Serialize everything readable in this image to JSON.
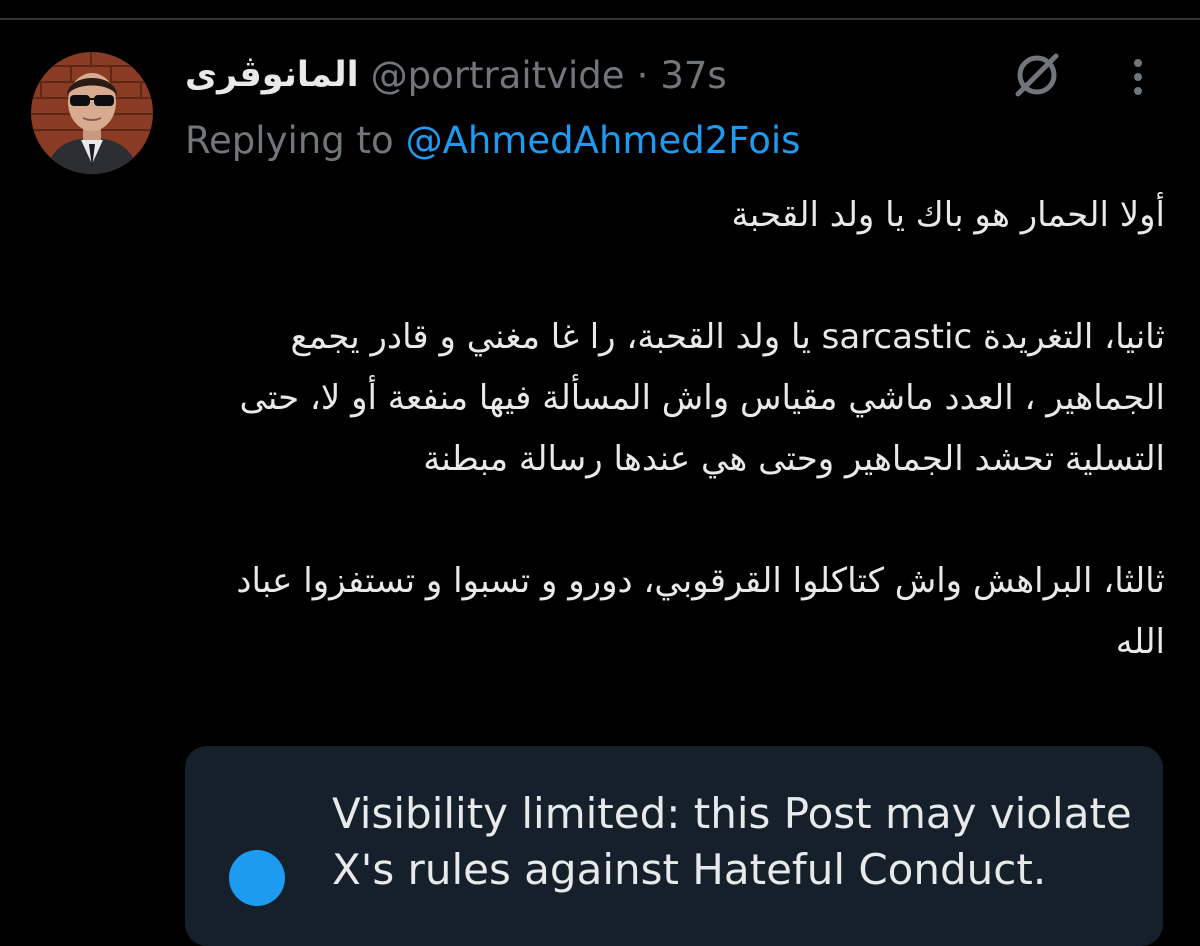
{
  "tweet": {
    "author": {
      "display_name": "المانوڤرى",
      "handle": "@portraitvide",
      "separator": "·",
      "timestamp": "37s"
    },
    "reply": {
      "prefix": "Replying to",
      "target": "@AhmedAhmed2Fois"
    },
    "paragraphs": [
      "أولا الحمار هو باك يا ولد القحبة",
      "ثانيا، التغريدة sarcastic يا ولد القحبة، را غا مغني و قادر يجمع الجماهير ، العدد ماشي مقياس واش المسألة فيها منفعة أو لا، حتى التسلية تحشد الجماهير وحتى هي عندها رسالة مبطنة",
      "ثالثا، البراهش واش كتاكلوا القرقوبي، دورو و تسبوا و تستفزوا عباد الله"
    ],
    "notice": {
      "line1": "Visibility limited: this Post may violate",
      "line2": "X's rules against Hateful Conduct."
    }
  },
  "icons": {
    "grok": "grok-icon",
    "more": "more-vertical-icon",
    "notice": "info-icon"
  },
  "colors": {
    "background": "#000000",
    "text_primary": "#e7e9ea",
    "text_secondary": "#71767b",
    "accent": "#1d9bf0",
    "notice_bg": "#16202a"
  }
}
